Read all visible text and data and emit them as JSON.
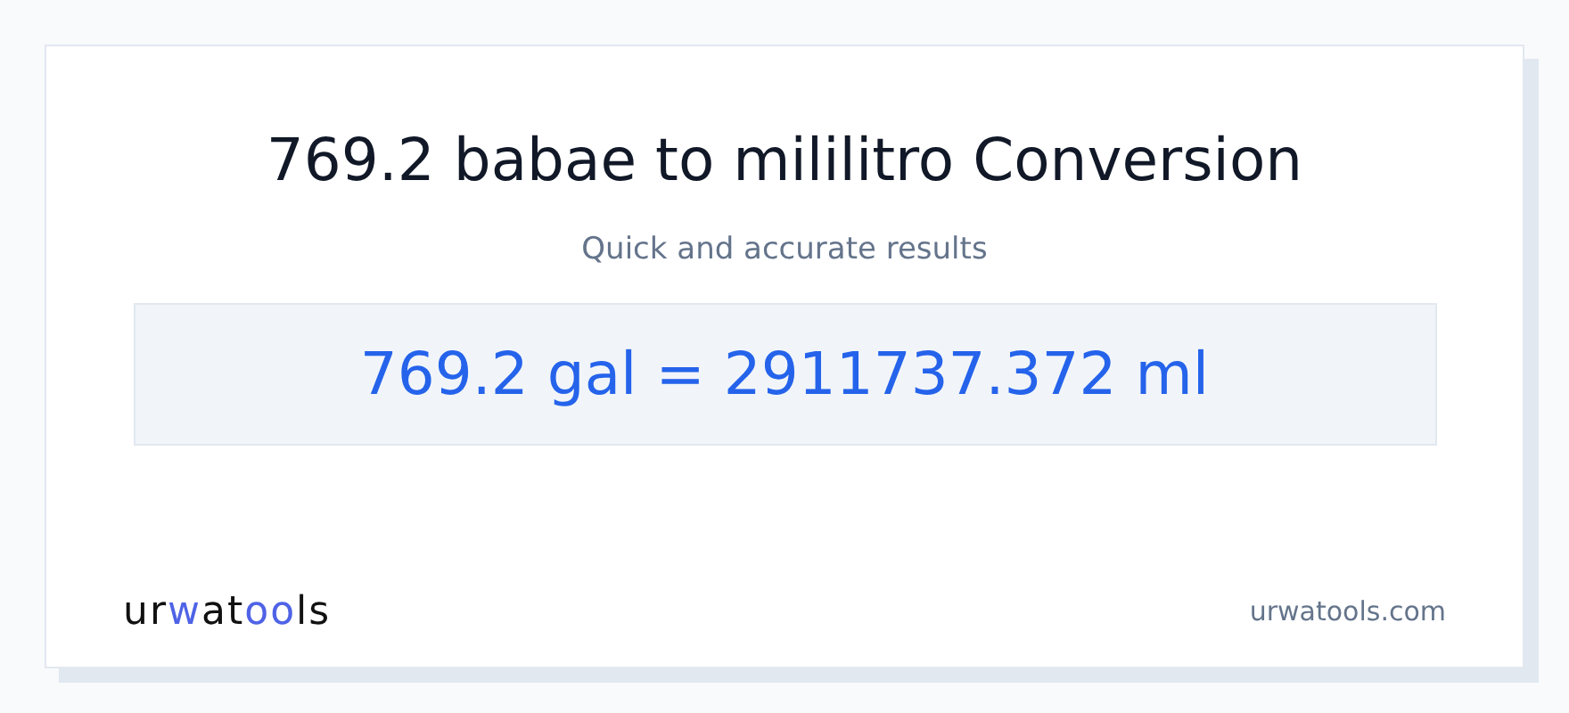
{
  "title": "769.2 babae to mililitro Conversion",
  "subtitle": "Quick and accurate results",
  "result": "769.2 gal = 2911737.372 ml",
  "logo": [
    {
      "text": "ur",
      "accent": false
    },
    {
      "text": "w",
      "accent": true
    },
    {
      "text": "at",
      "accent": false
    },
    {
      "text": "oo",
      "accent": true
    },
    {
      "text": "ls",
      "accent": false
    }
  ],
  "site": "urwatools.com"
}
